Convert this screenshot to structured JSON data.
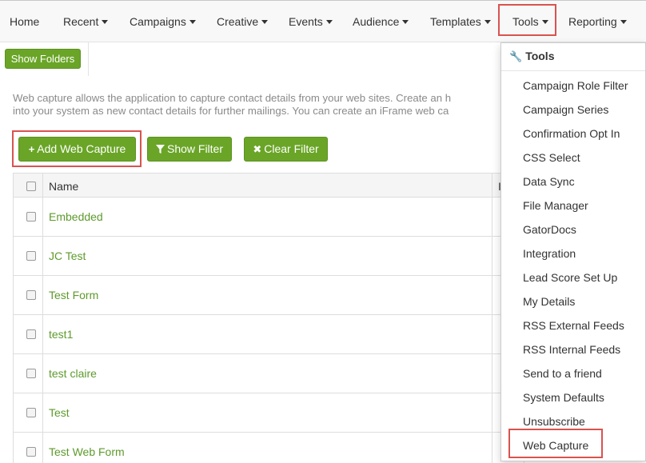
{
  "nav": {
    "items": [
      "Home",
      "Recent",
      "Campaigns",
      "Creative",
      "Events",
      "Audience",
      "Templates",
      "Tools",
      "Reporting"
    ]
  },
  "toolbar": {
    "show_folders": "Show Folders",
    "add_web_capture": "Add Web Capture",
    "show_filter": "Show Filter",
    "clear_filter": "Clear Filter"
  },
  "description": {
    "line1": "Web capture allows the application to capture contact details from your web sites. Create an h",
    "line2": "into your system as new contact details for further mailings. You can create an iFrame web ca"
  },
  "table": {
    "header_name": "Name",
    "header_extra": "I",
    "rows": [
      "Embedded",
      "JC Test",
      "Test Form",
      "test1",
      "test claire",
      "Test",
      "Test Web Form"
    ]
  },
  "dropdown": {
    "title": "Tools",
    "items": [
      "Campaign Role Filter",
      "Campaign Series",
      "Confirmation Opt In",
      "CSS Select",
      "Data Sync",
      "File Manager",
      "GatorDocs",
      "Integration",
      "Lead Score Set Up",
      "My Details",
      "RSS External Feeds",
      "RSS Internal Feeds",
      "Send to a friend",
      "System Defaults",
      "Unsubscribe",
      "Web Capture"
    ]
  },
  "colors": {
    "accent_green": "#6aa527",
    "link_green": "#5e9a2c",
    "highlight_red": "#d9534f"
  }
}
